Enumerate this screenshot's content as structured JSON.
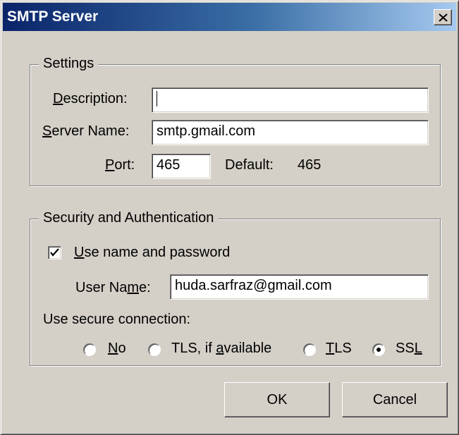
{
  "window": {
    "title": "SMTP Server"
  },
  "settings": {
    "legend": "Settings",
    "description_label_u": "D",
    "description_label_rest": "escription:",
    "description_value": "",
    "server_label_u": "S",
    "server_label_rest": "erver Name:",
    "server_value": "smtp.gmail.com",
    "port_label_u": "P",
    "port_label_rest": "ort:",
    "port_value": "465",
    "default_label": "Default:",
    "default_value": "465"
  },
  "security": {
    "legend": "Security and Authentication",
    "use_name_u": "U",
    "use_name_rest": "se name and password",
    "use_name_checked": true,
    "username_label_pre": "User Na",
    "username_label_u": "m",
    "username_label_post": "e:",
    "username_value": "huda.sarfraz@gmail.com",
    "secure_label": "Use secure connection:",
    "options": [
      {
        "pre": "",
        "u": "N",
        "post": "o",
        "selected": false
      },
      {
        "pre": "TLS, if ",
        "u": "a",
        "post": "vailable",
        "selected": false
      },
      {
        "pre": "",
        "u": "T",
        "post": "LS",
        "selected": false
      },
      {
        "pre": "SS",
        "u": "L",
        "post": "",
        "selected": true
      }
    ]
  },
  "buttons": {
    "ok": "OK",
    "cancel": "Cancel"
  }
}
